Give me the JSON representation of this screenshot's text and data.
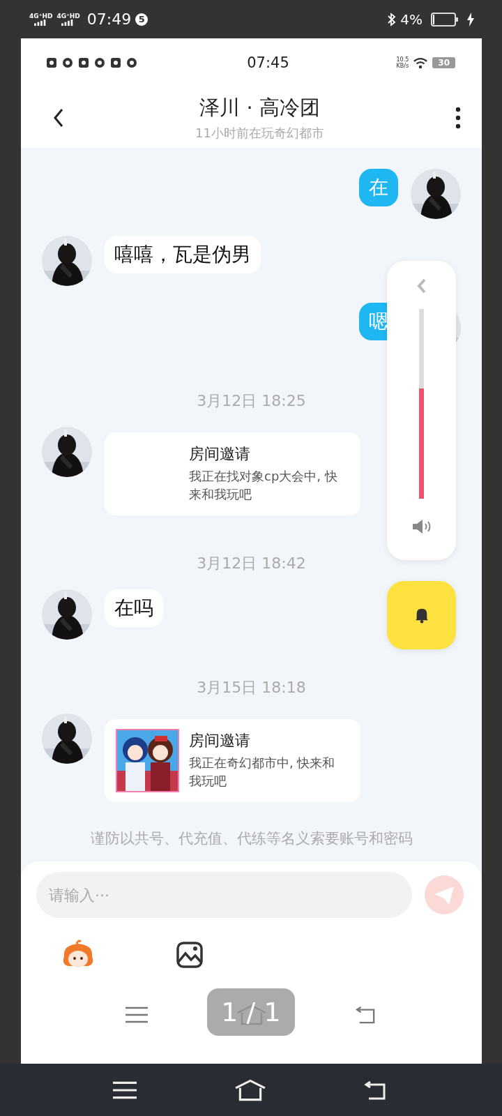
{
  "device_status": {
    "network_labels": [
      "4G⁺HD",
      "4G⁺HD"
    ],
    "time": "07:49",
    "notification_count": "5",
    "battery": "4%"
  },
  "screenshot": {
    "status_bar": {
      "time": "07:45",
      "speed": "10.5",
      "speed_unit": "KB/s",
      "battery": "30"
    },
    "header": {
      "title": "泽川 · 高冷团",
      "subtitle": "11小时前在玩奇幻都市"
    },
    "messages": [
      {
        "kind": "text",
        "outgoing": true,
        "text": "在"
      },
      {
        "kind": "text",
        "outgoing": false,
        "text": "嘻嘻，瓦是伪男"
      },
      {
        "kind": "text",
        "outgoing": true,
        "text": "嗯"
      },
      {
        "kind": "time",
        "text": "3月12日 18:25"
      },
      {
        "kind": "invite",
        "outgoing": false,
        "title": "房间邀请",
        "description": "我正在找对象cp大会中, 快来和我玩吧"
      },
      {
        "kind": "time",
        "text": "3月12日 18:42"
      },
      {
        "kind": "text",
        "outgoing": false,
        "text": "在吗"
      },
      {
        "kind": "time",
        "text": "3月15日 18:18"
      },
      {
        "kind": "invite",
        "outgoing": false,
        "title": "房间邀请",
        "description": "我正在奇幻都市中, 快来和我玩吧"
      }
    ],
    "notice": "谨防以共号、代充值、代练等名义索要账号和密码",
    "input": {
      "placeholder": "请输入···"
    },
    "volume": {
      "level": 0.58
    }
  },
  "viewer": {
    "page_indicator": "1 / 1"
  }
}
